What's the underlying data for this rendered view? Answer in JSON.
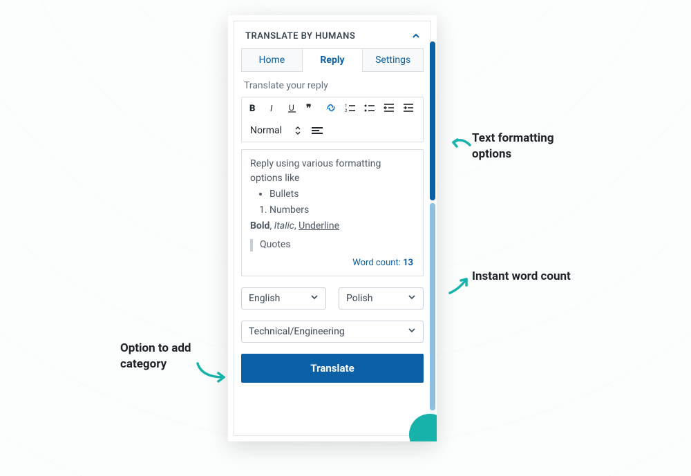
{
  "header": {
    "title": "TRANSLATE BY HUMANS"
  },
  "tabs": {
    "home": "Home",
    "reply": "Reply",
    "settings": "Settings"
  },
  "subtitle": "Translate your reply",
  "toolbar": {
    "normal": "Normal"
  },
  "editor": {
    "intro": "Reply using various formatting options like",
    "bullet": "Bullets",
    "number": "Numbers",
    "bold": "Bold",
    "sep": ", ",
    "italic": "Italic",
    "underline": "Underline",
    "quotes": "Quotes"
  },
  "wordcount": {
    "label": "Word count: ",
    "value": "13"
  },
  "lang": {
    "from": "English",
    "to": "Polish"
  },
  "category": "Technical/Engineering",
  "button": {
    "translate": "Translate"
  },
  "callouts": {
    "formatting": "Text formatting options",
    "wordcount": "Instant word count",
    "category": "Option to add category"
  }
}
